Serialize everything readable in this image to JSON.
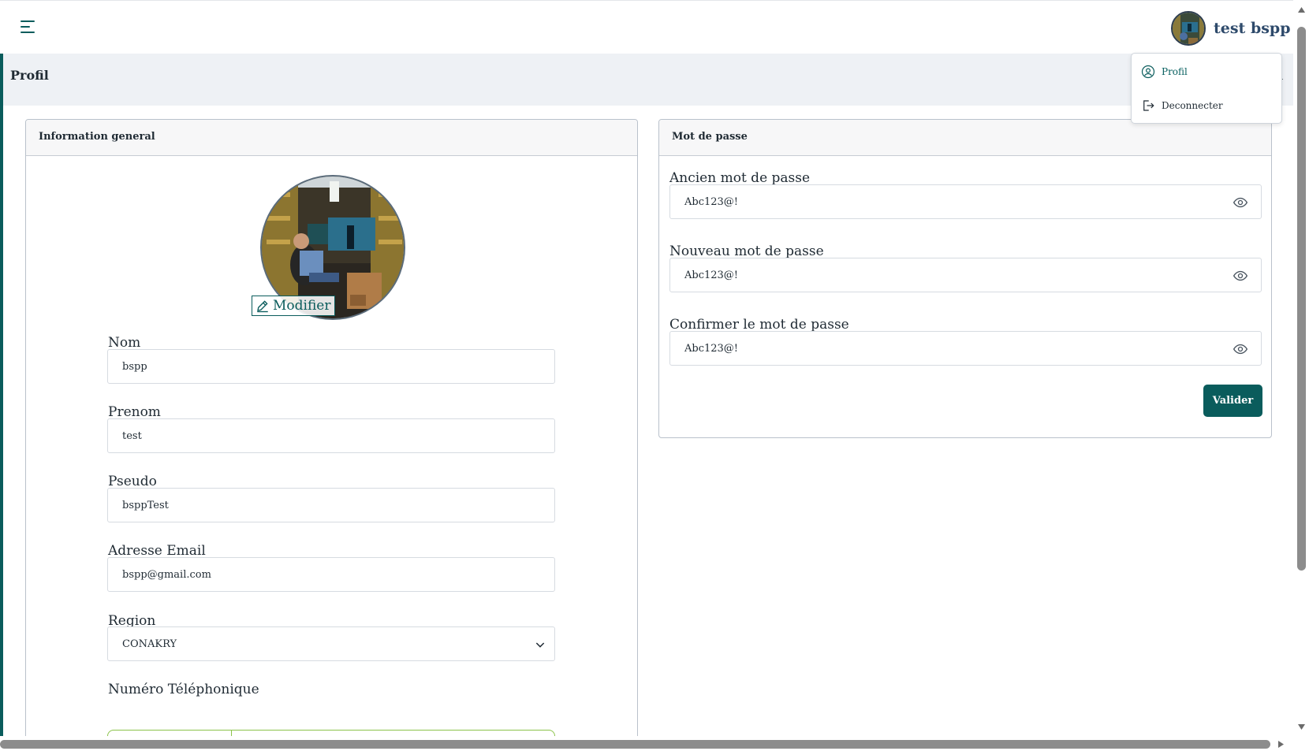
{
  "topbar": {
    "user_name": "test bspp"
  },
  "dropdown": {
    "profil_label": "Profil",
    "logout_label": "Deconnecter"
  },
  "page": {
    "title": "Profil",
    "title_right_fragment": "l"
  },
  "info_card": {
    "title": "Information general",
    "modifier_label": "Modifier",
    "fields": {
      "nom": {
        "label": "Nom",
        "value": "bspp"
      },
      "prenom": {
        "label": "Prenom",
        "value": "test"
      },
      "pseudo": {
        "label": "Pseudo",
        "value": "bsppTest"
      },
      "email": {
        "label": "Adresse Email",
        "value": "bspp@gmail.com"
      },
      "region": {
        "label": "Region",
        "value": "CONAKRY"
      },
      "phone": {
        "label": "Numéro Téléphonique"
      }
    }
  },
  "password_card": {
    "title": "Mot de passe",
    "fields": {
      "ancien": {
        "label": "Ancien mot de passe",
        "value": "Abc123@!"
      },
      "nouveau": {
        "label": "Nouveau mot de passe",
        "value": "Abc123@!"
      },
      "confirmer": {
        "label": "Confirmer le mot de passe",
        "value": "Abc123@!"
      }
    },
    "submit_label": "Valider"
  },
  "colors": {
    "primary": "#0a5c5c",
    "header_band": "#eef1f5",
    "user_name": "#2e4a6b",
    "phone_border": "#8bc34a"
  },
  "icons": {
    "menu": "hamburger-menu-icon",
    "profil": "user-circle-icon",
    "logout": "logout-icon",
    "edit": "pencil-icon",
    "eye": "eye-icon",
    "select": "chevron-down-icon"
  }
}
